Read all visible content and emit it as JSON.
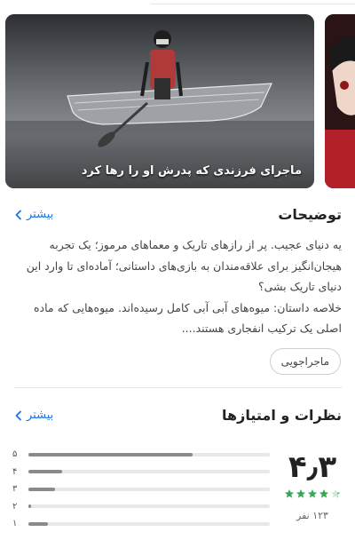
{
  "screenshots": {
    "caption": "ماجرای فرزندی که پدرش او را رها کرد"
  },
  "description_section": {
    "title": "توضیحات",
    "more_label": "بیشتر",
    "text": "یه دنیای عجیب. پر از رازهای تاریک و معماهای مرموز؛ یک تجربه هیجان‌انگیز برای علاقه‌مندان به بازی‌های داستانی؛ آماده‌ای تا وارد این دنیای تاریک بشی؟\nخلاصه داستان: میوه‌های آبی آبی کامل رسیده‌اند. میوه‌هایی که ماده اصلی یک ترکیب انفجاری هستند....",
    "tag_label": "ماجراجویی"
  },
  "ratings_section": {
    "title": "نظرات و امتیازها",
    "more_label": "بیشتر",
    "score": "۴٫۳",
    "stars_filled": 4.3,
    "count_text": "۱۲۳ نفر",
    "bars": [
      {
        "label": "۵",
        "fraction": 0.68
      },
      {
        "label": "۴",
        "fraction": 0.14
      },
      {
        "label": "۳",
        "fraction": 0.11
      },
      {
        "label": "۲",
        "fraction": 0.01
      },
      {
        "label": "۱",
        "fraction": 0.08
      }
    ]
  },
  "colors": {
    "accent": "#1a73e8",
    "star": "#3aa757",
    "bar_fill": "#8a8a8a"
  }
}
